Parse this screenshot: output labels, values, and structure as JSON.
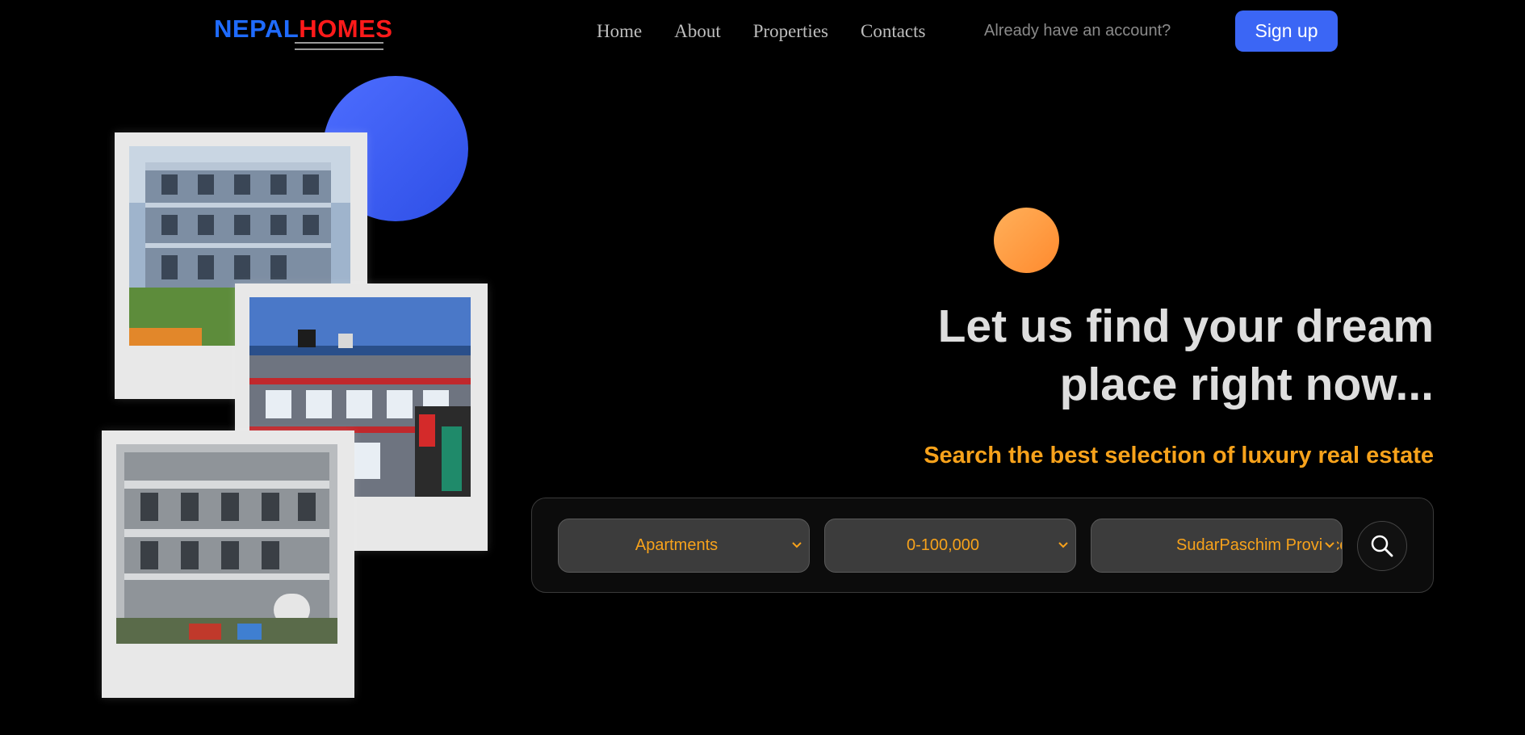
{
  "header": {
    "logo_part1": "NEPAL",
    "logo_part2": "HOMES",
    "nav": [
      "Home",
      "About",
      "Properties",
      "Contacts"
    ],
    "account_prompt": "Already have an account?",
    "signup_label": "Sign up"
  },
  "hero": {
    "title_line1": "Let us find your dream",
    "title_line2": "place right now...",
    "subtitle": "Search the best selection of luxury real estate"
  },
  "search": {
    "property_type": "Apartments",
    "price_range": "0-100,000",
    "province": "SudarPaschim Province"
  },
  "colors": {
    "accent_blue": "#3b66f5",
    "accent_orange": "#f7a21b",
    "logo_blue": "#1f6bff",
    "logo_red": "#ff1a1a"
  }
}
